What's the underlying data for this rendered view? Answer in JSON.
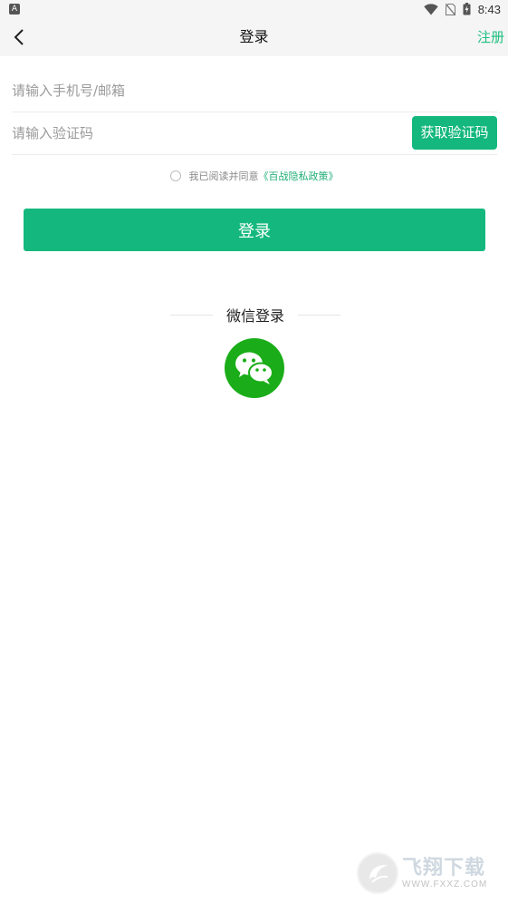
{
  "status_bar": {
    "time": "8:43",
    "notification_glyph": "A"
  },
  "nav": {
    "title": "登录",
    "register_label": "注册"
  },
  "form": {
    "phone_placeholder": "请输入手机号/邮箱",
    "phone_value": "",
    "code_placeholder": "请输入验证码",
    "code_value": "",
    "get_code_label": "获取验证码",
    "agree_text": "我已阅读并同意",
    "privacy_link": "《百战隐私政策》",
    "login_label": "登录"
  },
  "wechat": {
    "title": "微信登录"
  },
  "watermark": {
    "title": "飞翔下载",
    "url": "WWW.FXXZ.COM"
  },
  "colors": {
    "accent": "#14b87e",
    "wechat": "#1aad19",
    "register": "#1fbf7f"
  }
}
